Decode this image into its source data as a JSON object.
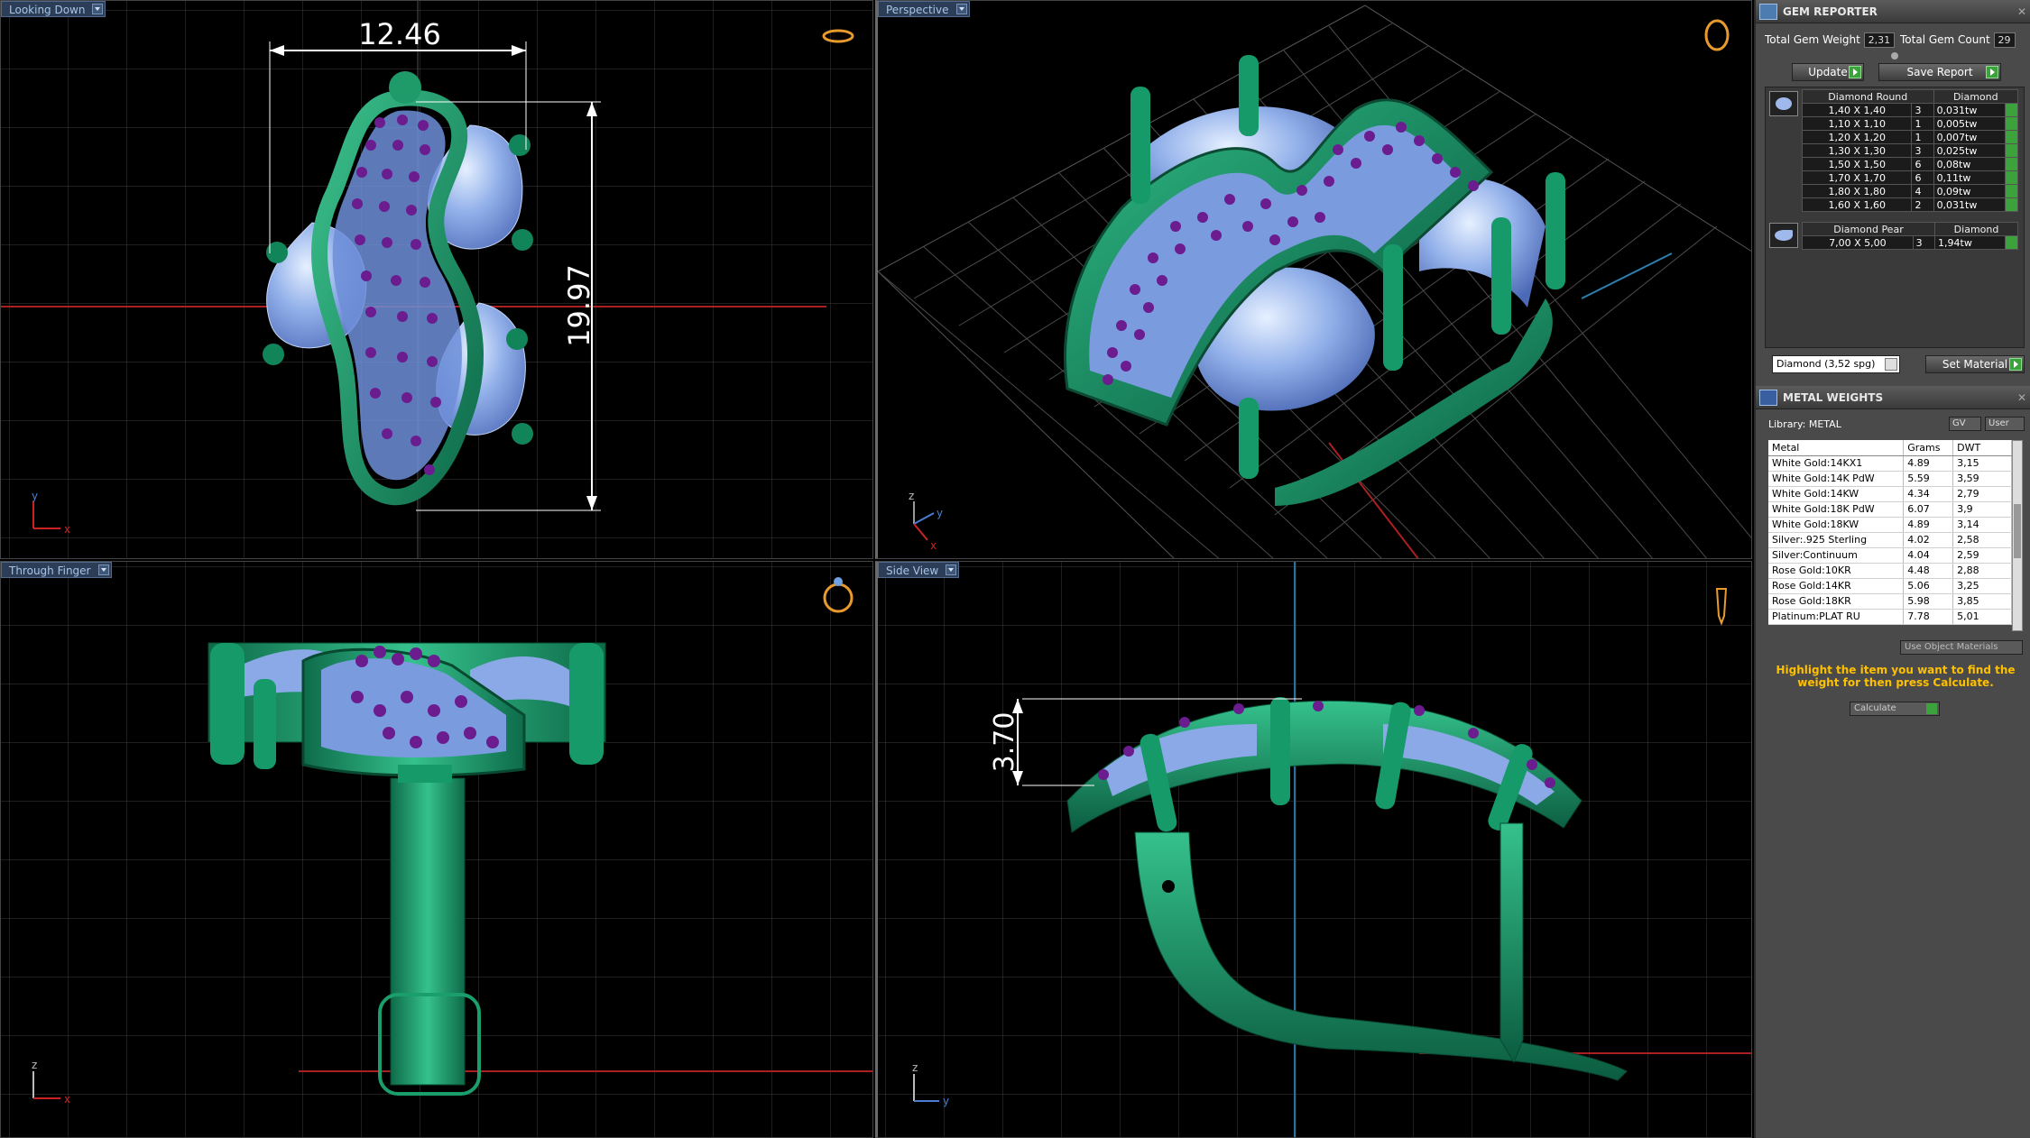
{
  "viewports": {
    "top_left": {
      "label": "Looking Down",
      "dim_width": "12.46",
      "dim_height": "19.97",
      "axis_x": "x",
      "axis_y": "y"
    },
    "top_right": {
      "label": "Perspective",
      "axis_x": "x",
      "axis_y": "y",
      "axis_z": "z"
    },
    "bottom_left": {
      "label": "Through Finger",
      "axis_x": "x",
      "axis_z": "z"
    },
    "bottom_right": {
      "label": "Side View",
      "dim_height": "3.70",
      "axis_y": "y",
      "axis_z": "z"
    }
  },
  "gem_reporter": {
    "title": "GEM REPORTER",
    "total_gem_weight_label": "Total Gem Weight",
    "total_gem_weight": "2,31",
    "total_gem_count_label": "Total Gem Count",
    "total_gem_count": "29",
    "update_label": "Update",
    "save_report_label": "Save Report",
    "groups": [
      {
        "name": "Diamond Round",
        "material": "Diamond",
        "rows": [
          [
            "1,40 X 1,40",
            "3",
            "0,031tw"
          ],
          [
            "1,10 X 1,10",
            "1",
            "0,005tw"
          ],
          [
            "1,20 X 1,20",
            "1",
            "0,007tw"
          ],
          [
            "1,30 X 1,30",
            "3",
            "0,025tw"
          ],
          [
            "1,50 X 1,50",
            "6",
            "0,08tw"
          ],
          [
            "1,70 X 1,70",
            "6",
            "0,11tw"
          ],
          [
            "1,80 X 1,80",
            "4",
            "0,09tw"
          ],
          [
            "1,60 X 1,60",
            "2",
            "0,031tw"
          ]
        ]
      },
      {
        "name": "Diamond Pear",
        "material": "Diamond",
        "rows": [
          [
            "7,00 X 5,00",
            "3",
            "1,94tw"
          ]
        ]
      }
    ],
    "material_select": "Diamond    (3,52 spg)",
    "set_material_label": "Set Material"
  },
  "metal_weights": {
    "title": "METAL WEIGHTS",
    "library_label": "Library: METAL",
    "gv_label": "GV",
    "user_label": "User",
    "columns": [
      "Metal",
      "Grams",
      "DWT"
    ],
    "rows": [
      [
        "White Gold:14KX1",
        "4.89",
        "3,15"
      ],
      [
        "White Gold:14K PdW",
        "5.59",
        "3,59"
      ],
      [
        "White Gold:14KW",
        "4.34",
        "2,79"
      ],
      [
        "White Gold:18K PdW",
        "6.07",
        "3,9"
      ],
      [
        "White Gold:18KW",
        "4.89",
        "3,14"
      ],
      [
        "Silver:.925 Sterling",
        "4.02",
        "2,58"
      ],
      [
        "Silver:Continuum",
        "4.04",
        "2,59"
      ],
      [
        "Rose Gold:10KR",
        "4.48",
        "2,88"
      ],
      [
        "Rose Gold:14KR",
        "5.06",
        "3,25"
      ],
      [
        "Rose Gold:18KR",
        "5.98",
        "3,85"
      ],
      [
        "Platinum:PLAT RU",
        "7.78",
        "5,01"
      ]
    ],
    "use_object_materials_label": "Use Object Materials",
    "note": "Highlight the item you want to find the weight for then press Calculate.",
    "calculate_label": "Calculate"
  }
}
